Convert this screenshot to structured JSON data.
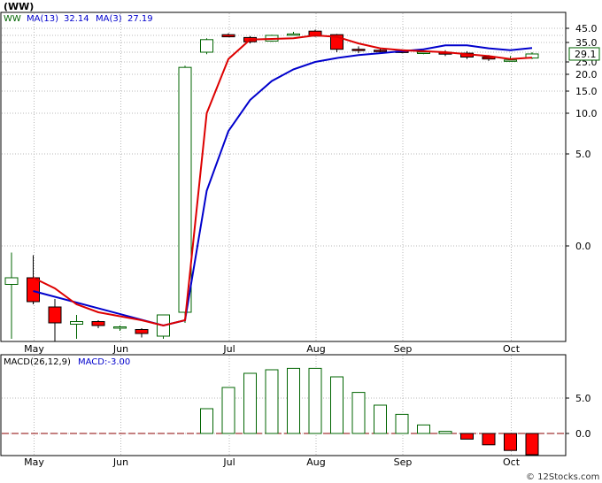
{
  "title": "(WW)",
  "watermark": "© 12Stocks.com",
  "colors": {
    "up_candle": "#006400",
    "down_candle": "#ff0000",
    "ma13": "#0000cc",
    "ma3": "#dd0000",
    "macd_pos": "#006400",
    "macd_neg": "#ff0000",
    "grid": "#b8b8b8",
    "last_price_box": "#006400"
  },
  "price_panel": {
    "legend": {
      "symbol": "WW",
      "ma13_label": "MA(13)",
      "ma13_value": "32.14",
      "ma3_label": "MA(3)",
      "ma3_value": "27.19"
    },
    "y_ticks": [
      "45.0",
      "35.0",
      "25.0",
      "20.0",
      "15.0",
      "10.0",
      "5.0",
      "0.0"
    ],
    "last_price": "29.1"
  },
  "macd_panel": {
    "label": "MACD(26,12,9)",
    "value_label": "MACD:-3.00",
    "y_ticks": [
      "5.0",
      "0.0"
    ]
  },
  "x_ticks": [
    "May",
    "Jun",
    "Jul",
    "Aug",
    "Sep",
    "Oct"
  ],
  "chart_data": [
    {
      "type": "candlestick",
      "title": "(WW)",
      "xlabel": "",
      "ylabel": "",
      "y_tick_labels": [
        "45.0",
        "35.0",
        "25.0",
        "20.0",
        "15.0",
        "10.0",
        "5.0",
        "0.0"
      ],
      "x_tick_labels": [
        "May",
        "Jun",
        "Jul",
        "Aug",
        "Sep",
        "Oct"
      ],
      "grid": true,
      "weeks": [
        {
          "o": -1.45,
          "h": -0.25,
          "l": -3.5,
          "c": -1.2
        },
        {
          "o": -1.2,
          "h": -0.35,
          "l": -2.2,
          "c": -2.1
        },
        {
          "o": -2.3,
          "h": -2.0,
          "l": -3.6,
          "c": -2.9
        },
        {
          "o": -2.95,
          "h": -2.6,
          "l": -3.5,
          "c": -2.85
        },
        {
          "o": -2.85,
          "h": -2.8,
          "l": -3.1,
          "c": -3.0
        },
        {
          "o": -3.05,
          "h": -3.0,
          "l": -3.2,
          "c": -3.05
        },
        {
          "o": -3.15,
          "h": -3.1,
          "l": -3.45,
          "c": -3.3
        },
        {
          "o": -3.4,
          "h": -2.8,
          "l": -3.5,
          "c": -2.6
        },
        {
          "o": -2.5,
          "h": 23.5,
          "l": -2.9,
          "c": 22.8
        },
        {
          "o": 30.0,
          "h": 38.0,
          "l": 29.0,
          "c": 37.0
        },
        {
          "o": 40.5,
          "h": 41.5,
          "l": 39.0,
          "c": 39.0
        },
        {
          "o": 38.5,
          "h": 39.5,
          "l": 34.5,
          "c": 35.5
        },
        {
          "o": 36.0,
          "h": 40.5,
          "l": 35.5,
          "c": 40.0
        },
        {
          "o": 40.5,
          "h": 42.5,
          "l": 40.0,
          "c": 41.0
        },
        {
          "o": 43.0,
          "h": 44.0,
          "l": 39.0,
          "c": 39.5
        },
        {
          "o": 40.5,
          "h": 41.0,
          "l": 30.0,
          "c": 31.5
        },
        {
          "o": 31.5,
          "h": 33.0,
          "l": 29.5,
          "c": 31.0
        },
        {
          "o": 31.0,
          "h": 32.0,
          "l": 30.0,
          "c": 30.5
        },
        {
          "o": 30.5,
          "h": 31.5,
          "l": 29.5,
          "c": 30.0
        },
        {
          "o": 30.0,
          "h": 31.0,
          "l": 29.0,
          "c": 30.0
        },
        {
          "o": 30.0,
          "h": 31.0,
          "l": 28.0,
          "c": 29.0
        },
        {
          "o": 29.5,
          "h": 30.5,
          "l": 26.5,
          "c": 27.5
        },
        {
          "o": 27.5,
          "h": 28.5,
          "l": 25.5,
          "c": 26.5
        },
        {
          "o": 26.0,
          "h": 28.0,
          "l": 25.5,
          "c": 26.0
        },
        {
          "o": 27.0,
          "h": 30.0,
          "l": 26.5,
          "c": 29.1
        }
      ],
      "ma13": [
        null,
        -1.7,
        null,
        null,
        null,
        null,
        null,
        -3.0,
        -2.8,
        3.0,
        7.8,
        13.0,
        18.0,
        22.0,
        25.0,
        27.0,
        28.5,
        29.5,
        30.5,
        31.5,
        33.5,
        33.5,
        32.0,
        31.0,
        32.14
      ],
      "ma3": [
        null,
        -1.2,
        -1.6,
        -2.2,
        -2.5,
        -2.65,
        -2.8,
        -3.0,
        -2.8,
        10.0,
        26.5,
        37.0,
        37.5,
        38.0,
        40.0,
        39.0,
        34.5,
        32.0,
        31.0,
        30.5,
        30.0,
        29.0,
        28.0,
        26.5,
        27.19
      ],
      "macd": [
        0,
        0,
        0,
        0,
        0,
        0,
        0,
        0,
        0,
        3.5,
        6.5,
        8.5,
        9.0,
        9.2,
        9.2,
        8.0,
        5.8,
        4.0,
        2.7,
        1.2,
        0.3,
        -0.8,
        -1.6,
        -2.4,
        -3.0
      ]
    }
  ]
}
